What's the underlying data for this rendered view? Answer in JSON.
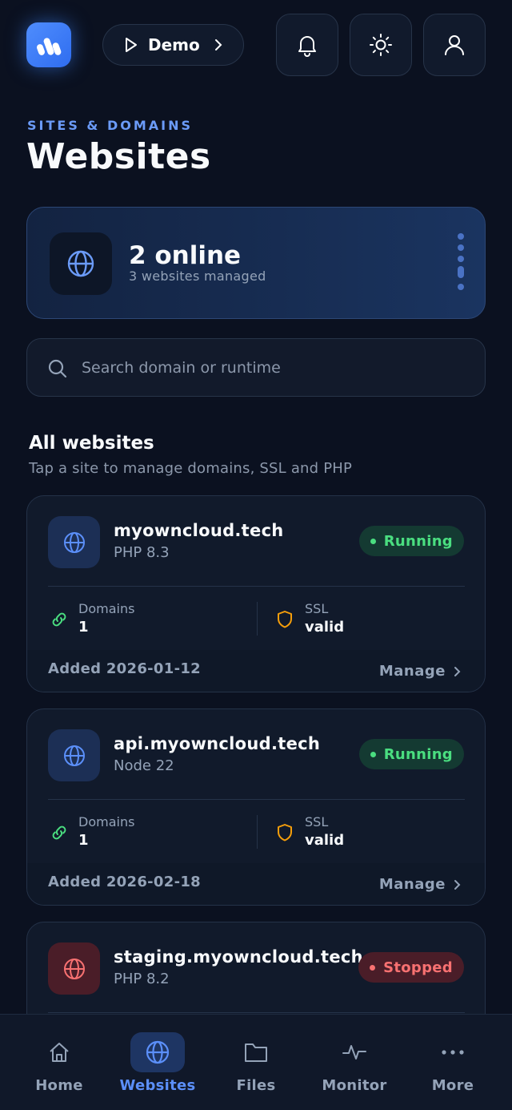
{
  "header": {
    "env_label": "Demo"
  },
  "page": {
    "eyebrow": "SITES & DOMAINS",
    "title": "Websites"
  },
  "summary": {
    "online": "2 online",
    "managed": "3 websites managed"
  },
  "search": {
    "placeholder": "Search domain or runtime"
  },
  "section": {
    "title": "All websites",
    "subtitle": "Tap a site to manage domains, SSL and PHP"
  },
  "sites": [
    {
      "name": "myowncloud.tech",
      "runtime": "PHP 8.3",
      "status": "Running",
      "domains_label": "Domains",
      "domains": "1",
      "ssl_label": "SSL",
      "ssl": "valid",
      "added": "Added 2026-01-12",
      "manage": "Manage"
    },
    {
      "name": "api.myowncloud.tech",
      "runtime": "Node 22",
      "status": "Running",
      "domains_label": "Domains",
      "domains": "1",
      "ssl_label": "SSL",
      "ssl": "valid",
      "added": "Added 2026-02-18",
      "manage": "Manage"
    },
    {
      "name": "staging.myowncloud.tech",
      "runtime": "PHP 8.2",
      "status": "Stopped"
    }
  ],
  "nav": [
    {
      "label": "Home",
      "icon": "home-icon"
    },
    {
      "label": "Websites",
      "icon": "globe-icon",
      "active": true
    },
    {
      "label": "Files",
      "icon": "folder-icon"
    },
    {
      "label": "Monitor",
      "icon": "activity-icon"
    },
    {
      "label": "More",
      "icon": "more-icon"
    }
  ],
  "colors": {
    "accent": "#5b8ff9",
    "running": "#4ade80",
    "stopped": "#f87171",
    "background": "#0b1120"
  }
}
